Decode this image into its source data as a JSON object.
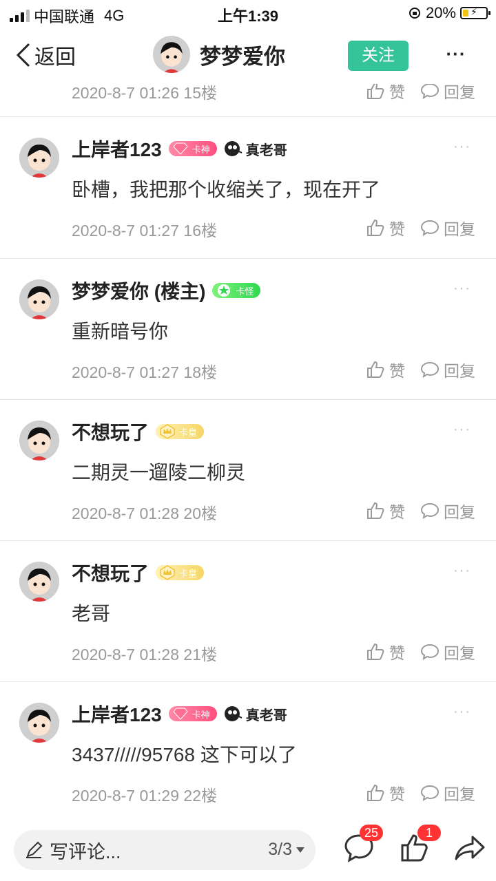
{
  "status_bar": {
    "carrier": "中国联通",
    "network": "4G",
    "time": "上午1:39",
    "battery": "20%"
  },
  "nav": {
    "back_label": "返回",
    "title": "梦梦爱你",
    "follow_label": "关注",
    "more_label": "···"
  },
  "partial_post": {
    "meta": "2020-8-7 01:26  15楼",
    "like_label": "赞",
    "reply_label": "回复"
  },
  "posts": [
    {
      "name": "上岸者123",
      "level_badge": "卡神",
      "title_badge": "真老哥",
      "content": "卧槽，我把那个收缩关了，现在开了",
      "meta": "2020-8-7 01:27  16楼",
      "like_label": "赞",
      "reply_label": "回复"
    },
    {
      "name": "梦梦爱你 (楼主)",
      "level_badge": "卡怪",
      "content": "重新暗号你",
      "meta": "2020-8-7 01:27  18楼",
      "like_label": "赞",
      "reply_label": "回复"
    },
    {
      "name": "不想玩了",
      "level_badge": "卡皇",
      "content": "二期灵一遛陵二柳灵",
      "meta": "2020-8-7 01:28  20楼",
      "like_label": "赞",
      "reply_label": "回复"
    },
    {
      "name": "不想玩了",
      "level_badge": "卡皇",
      "content": "老哥",
      "meta": "2020-8-7 01:28  21楼",
      "like_label": "赞",
      "reply_label": "回复"
    },
    {
      "name": "上岸者123",
      "level_badge": "卡神",
      "title_badge": "真老哥",
      "content": "3437/////95768    这下可以了",
      "meta": "2020-8-7 01:29  22楼",
      "like_label": "赞",
      "reply_label": "回复"
    }
  ],
  "bottom_bar": {
    "comment_placeholder": "写评论...",
    "page_indicator": "3/3",
    "comment_count": "25",
    "like_count": "1"
  },
  "colors": {
    "follow_button": "#35c39a",
    "badge_red": "#ff3333",
    "meta_gray": "#999999"
  }
}
